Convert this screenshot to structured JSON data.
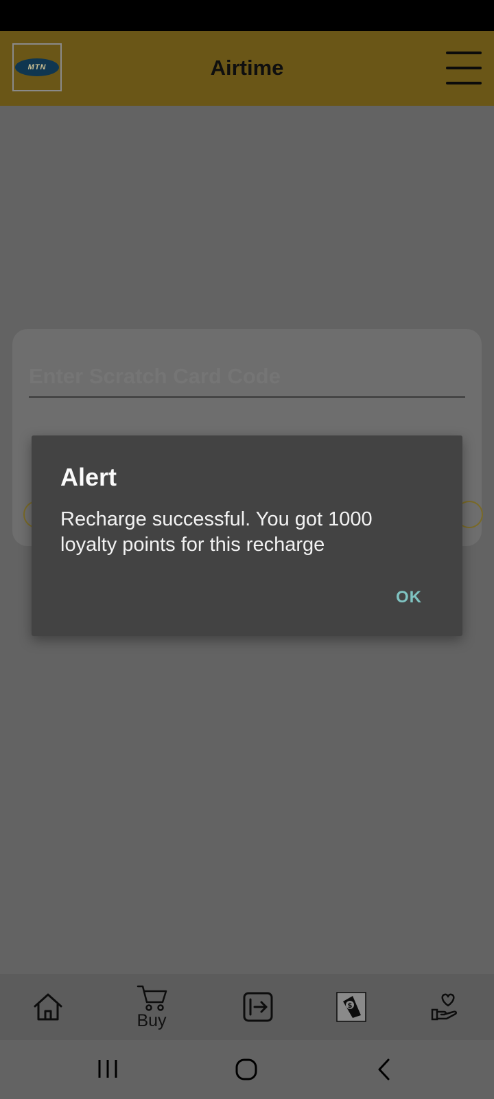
{
  "app_bar": {
    "title": "Airtime",
    "logo_text": "MTN"
  },
  "form": {
    "code_placeholder": "Enter Scratch Card Code"
  },
  "dialog": {
    "title": "Alert",
    "message": "Recharge successful. You got 1000 loyalty points for this recharge",
    "ok_label": "OK"
  },
  "bottom_nav": {
    "items": [
      {
        "icon": "home-icon",
        "label": ""
      },
      {
        "icon": "cart-icon",
        "label": "Buy"
      },
      {
        "icon": "transfer-icon",
        "label": ""
      },
      {
        "icon": "money-icon",
        "label": ""
      },
      {
        "icon": "heart-hand-icon",
        "label": ""
      }
    ]
  },
  "system_nav": [
    "recent-apps-icon",
    "home-circle-icon",
    "back-icon"
  ],
  "colors": {
    "app_bar": "#6a5617",
    "dim_background": "#636363",
    "dialog_bg": "#434343",
    "ok_accent": "#7fc3c1"
  }
}
